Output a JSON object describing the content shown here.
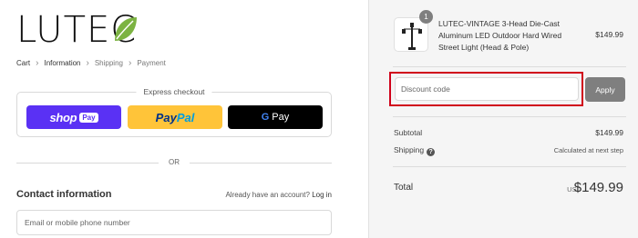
{
  "brand": {
    "name": "LUTEC",
    "leaf_color": "#7cb342"
  },
  "breadcrumb": [
    {
      "label": "Cart"
    },
    {
      "label": "Information"
    },
    {
      "label": "Shipping"
    },
    {
      "label": "Payment"
    }
  ],
  "express": {
    "title": "Express checkout",
    "shop_label": "shop",
    "shop_pill": "Pay",
    "paypal_label_1": "Pay",
    "paypal_label_2": "Pal",
    "gpay_g": "G",
    "gpay_label": "Pay"
  },
  "or_label": "OR",
  "contact": {
    "title": "Contact information",
    "account_prompt": "Already have an account?",
    "login_label": "Log in",
    "email_placeholder": "Email or mobile phone number"
  },
  "order": {
    "quantity": "1",
    "product_name": "LUTEC-VINTAGE 3-Head Die-Cast Aluminum LED Outdoor Hard Wired Street Light (Head & Pole)",
    "product_price": "$149.99",
    "discount_placeholder": "Discount code",
    "apply_label": "Apply",
    "subtotal_label": "Subtotal",
    "subtotal_value": "$149.99",
    "shipping_label": "Shipping",
    "shipping_value": "Calculated at next step",
    "total_label": "Total",
    "currency": "USD",
    "total_value": "$149.99"
  },
  "colors": {
    "highlight": "#d0021b",
    "shop_pay": "#5a31f4",
    "paypal": "#ffc439",
    "gpay": "#000000",
    "apply": "#7f7f7f"
  }
}
